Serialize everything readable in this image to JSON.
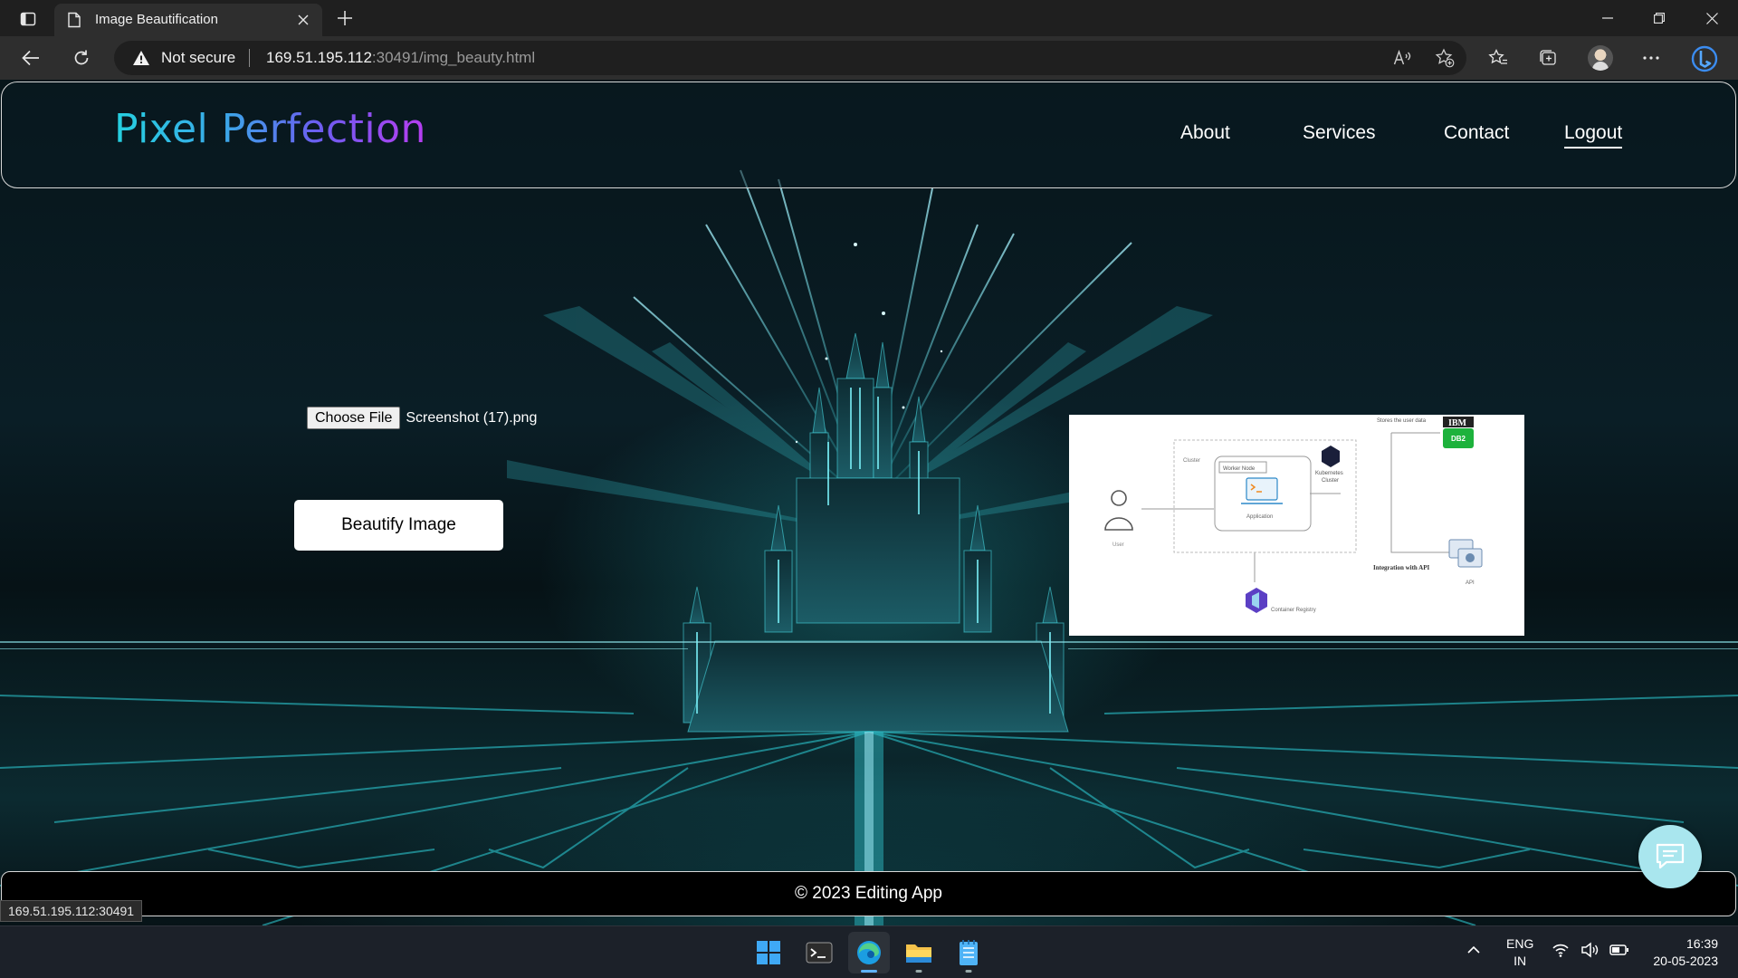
{
  "browser": {
    "tab_title": "Image Beautification",
    "security_label": "Not secure",
    "url_host": "169.51.195.112",
    "url_rest": ":30491/img_beauty.html",
    "status_url": "169.51.195.112:30491"
  },
  "page": {
    "brand": "Pixel Perfection",
    "nav": [
      {
        "label": "About"
      },
      {
        "label": "Services"
      },
      {
        "label": "Contact"
      },
      {
        "label": "Logout"
      }
    ],
    "file_input": {
      "button_label": "Choose File",
      "file_name": "Screenshot (17).png"
    },
    "beautify_button": "Beautify Image",
    "footer": "© 2023 Editing App",
    "preview": {
      "labels": {
        "stores": "Stores the user data",
        "ibm": "IBM",
        "db2": "DB2",
        "cluster": "Cluster",
        "worker_node": "Worker Node",
        "kubernetes": "Kubernetes",
        "kubernetes2": "Cluster",
        "application": "Application",
        "user": "User",
        "integration": "Integration with API",
        "api": "API",
        "registry": "Container Registry"
      }
    }
  },
  "taskbar": {
    "lang_top": "ENG",
    "lang_bottom": "IN",
    "time": "16:39",
    "date": "20-05-2023"
  },
  "colors": {
    "brand_gradient_start": "#25d0e0",
    "brand_gradient_end": "#b73df0",
    "chat_button": "#a9e6ee"
  }
}
